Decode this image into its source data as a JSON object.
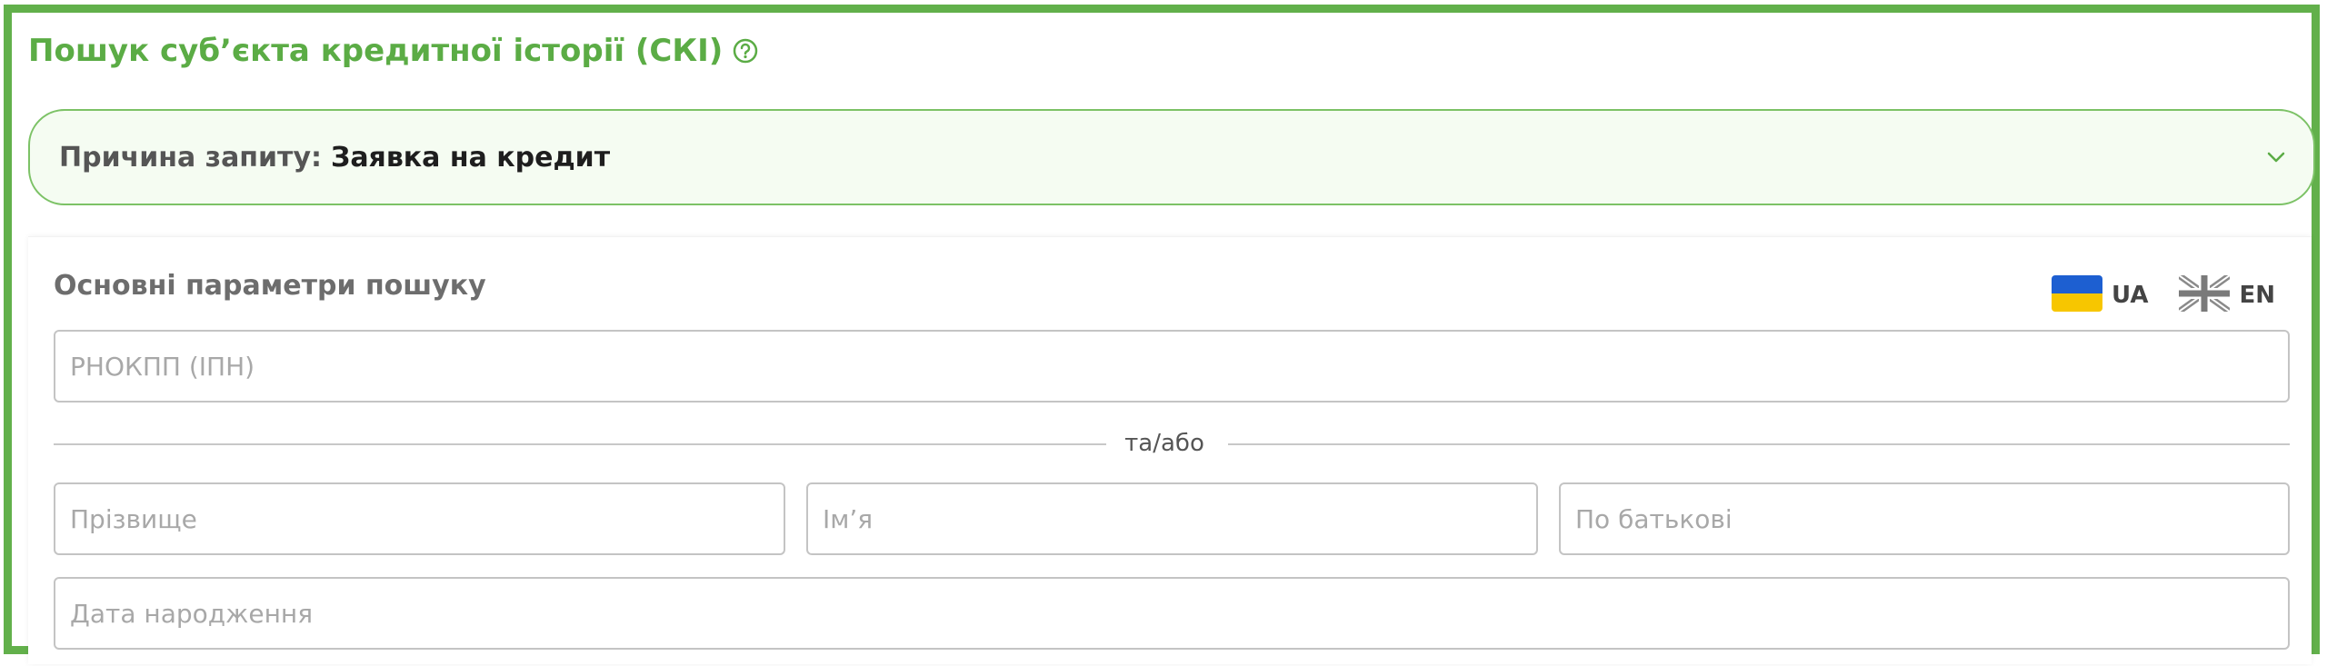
{
  "header": {
    "title": "Пошук суб’єкта кредитної історії (СКІ)",
    "help_icon": "question-circle-icon"
  },
  "request_reason": {
    "label": "Причина запиту:",
    "value": "Заявка на кредит",
    "chevron_icon": "chevron-down-icon"
  },
  "search": {
    "section_title": "Основні параметри пошуку",
    "languages": [
      {
        "code": "UA",
        "flag_icon": "ukraine-flag-icon"
      },
      {
        "code": "EN",
        "flag_icon": "uk-flag-icon"
      }
    ],
    "tax_id_placeholder": "РНОКПП (ІПН)",
    "divider_text": "та/або",
    "last_name_placeholder": "Прізвище",
    "first_name_placeholder": "Ім’я",
    "patronymic_placeholder": "По батькові",
    "birth_date_placeholder": "Дата народження"
  },
  "colors": {
    "accent_green": "#5bac45",
    "frame_green": "#62b04b",
    "panel_bg": "#f5fcf2",
    "ua_flag_blue": "#1d5fd1",
    "ua_flag_yellow": "#f7c600"
  }
}
